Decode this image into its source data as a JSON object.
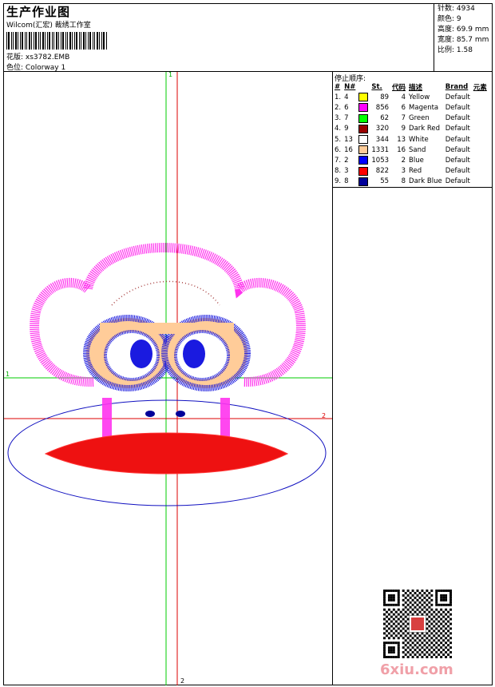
{
  "header": {
    "title": "生产作业图",
    "company": "Wilcom(汇宏)  裁绣工作室",
    "design_label": "花版:",
    "design_value": "xs3782.EMB",
    "colorway_label": "色位:",
    "colorway_value": "Colorway 1"
  },
  "stats": [
    {
      "label": "针数:",
      "value": "4934"
    },
    {
      "label": "颜色:",
      "value": "9"
    },
    {
      "label": "高度:",
      "value": "69.9 mm"
    },
    {
      "label": "宽度:",
      "value": "85.7 mm"
    },
    {
      "label": "比例:",
      "value": "1.58"
    }
  ],
  "stop_sequence": {
    "title": "停止顺序:",
    "headers": [
      "#",
      "N#",
      "St.",
      "代码",
      "描述",
      "Brand",
      "元素"
    ],
    "rows": [
      {
        "idx": "1.",
        "n": "4",
        "color": "#ffff00",
        "st": "89",
        "code": "4",
        "desc": "Yellow",
        "brand": "Default"
      },
      {
        "idx": "2.",
        "n": "6",
        "color": "#ff00ff",
        "st": "856",
        "code": "6",
        "desc": "Magenta",
        "brand": "Default"
      },
      {
        "idx": "3.",
        "n": "7",
        "color": "#00ff00",
        "st": "62",
        "code": "7",
        "desc": "Green",
        "brand": "Default"
      },
      {
        "idx": "4.",
        "n": "9",
        "color": "#990000",
        "st": "320",
        "code": "9",
        "desc": "Dark Red",
        "brand": "Default"
      },
      {
        "idx": "5.",
        "n": "13",
        "color": "#ffffff",
        "st": "344",
        "code": "13",
        "desc": "White",
        "brand": "Default"
      },
      {
        "idx": "6.",
        "n": "16",
        "color": "#ffcc99",
        "st": "1331",
        "code": "16",
        "desc": "Sand",
        "brand": "Default"
      },
      {
        "idx": "7.",
        "n": "2",
        "color": "#0000ff",
        "st": "1053",
        "code": "2",
        "desc": "Blue",
        "brand": "Default"
      },
      {
        "idx": "8.",
        "n": "3",
        "color": "#ff0000",
        "st": "822",
        "code": "3",
        "desc": "Red",
        "brand": "Default"
      },
      {
        "idx": "9.",
        "n": "8",
        "color": "#000099",
        "st": "55",
        "code": "8",
        "desc": "Dark Blue",
        "brand": "Default"
      }
    ]
  },
  "guides": {
    "green_v_label": "1",
    "green_h_label": "1",
    "red_h_label": "2",
    "red_v_label": "2"
  },
  "watermark": "6xiu.com",
  "icons": {
    "qr": "qr-code-icon",
    "barcode": "barcode-icon"
  }
}
